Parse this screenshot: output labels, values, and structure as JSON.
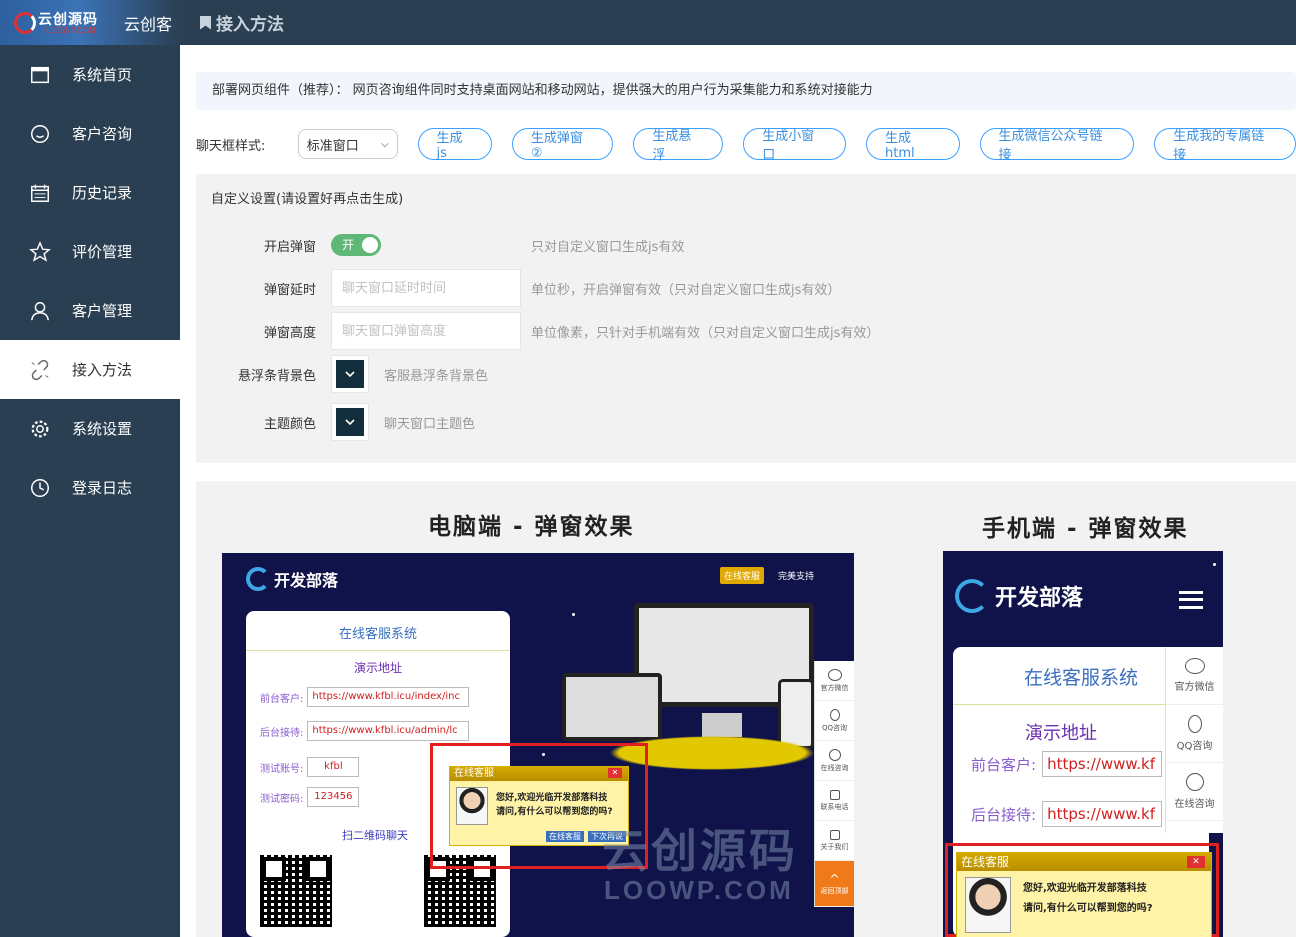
{
  "app": {
    "logo_text": "云创源码",
    "logo_sub": "LOOWP.COM",
    "name": "云创客"
  },
  "sidebar": {
    "items": [
      {
        "label": "系统首页",
        "icon": "window-icon"
      },
      {
        "label": "客户咨询",
        "icon": "smile-icon"
      },
      {
        "label": "历史记录",
        "icon": "calendar-icon"
      },
      {
        "label": "评价管理",
        "icon": "star-icon"
      },
      {
        "label": "客户管理",
        "icon": "users-icon"
      },
      {
        "label": "接入方法",
        "icon": "link-icon",
        "active": true
      },
      {
        "label": "系统设置",
        "icon": "gear-icon"
      },
      {
        "label": "登录日志",
        "icon": "clock-icon"
      }
    ]
  },
  "header": {
    "title": "接入方法"
  },
  "notice": "部署网页组件（推荐）： 网页咨询组件同时支持桌面网站和移动网站，提供强大的用户行为采集能力和系统对接能力",
  "style_row": {
    "label": "聊天框样式:",
    "select_value": "标准窗口",
    "buttons": [
      "生成js",
      "生成弹窗②",
      "生成悬浮",
      "生成小窗口",
      "生成html",
      "生成微信公众号链接",
      "生成我的专属链接"
    ]
  },
  "custom": {
    "title": "自定义设置(请设置好再点击生成)",
    "popup_toggle": {
      "label": "开启弹窗",
      "state": "开",
      "hint": "只对自定义窗口生成js有效"
    },
    "delay": {
      "label": "弹窗延时",
      "placeholder": "聊天窗口延时时间",
      "hint": "单位秒，开启弹窗有效（只对自定义窗口生成js有效）"
    },
    "height": {
      "label": "弹窗高度",
      "placeholder": "聊天窗口弹窗高度",
      "hint": "单位像素，只针对手机端有效（只对自定义窗口生成js有效）"
    },
    "float_color": {
      "label": "悬浮条背景色",
      "hint": "客服悬浮条背景色",
      "color": "#132e3c"
    },
    "theme_color": {
      "label": "主题颜色",
      "hint": "聊天窗口主题色",
      "color": "#132e3c"
    }
  },
  "preview": {
    "pc_title": "电脑端 - 弹窗效果",
    "mobile_title": "手机端 - 弹窗效果",
    "pc": {
      "brand": "开发部落",
      "nav_online": "在线客服",
      "nav_support": "完美支持",
      "card_title": "在线客服系统",
      "demo": "演示地址",
      "front_label": "前台客户:",
      "front_url": "https://www.kfbl.icu/index/inc",
      "back_label": "后台接待:",
      "back_url": "https://www.kfbl.icu/admin/lc",
      "account_label": "测试账号:",
      "account": "kfbl",
      "password_label": "测试密码:",
      "password": "123456",
      "scan": "扫二维码聊天",
      "popup_title": "在线客服",
      "popup_msg1": "您好,欢迎光临开发部落科技",
      "popup_msg2": "请问,有什么可以帮到您的吗?",
      "popup_btn1": "在线客服",
      "popup_btn2": "下次再说",
      "rail": [
        "官方微信",
        "QQ咨询",
        "在线咨询",
        "联系电话",
        "关于我们",
        "返回顶部"
      ]
    },
    "mobile": {
      "brand": "开发部落",
      "card_title": "在线客服系统",
      "demo": "演示地址",
      "front_label": "前台客户:",
      "front_url": "https://www.kf",
      "back_label": "后台接待:",
      "back_url": "https://www.kf",
      "popup_title": "在线客服",
      "popup_msg1": "您好,欢迎光临开发部落科技",
      "popup_msg2": "请问,有什么可以帮到您的吗?",
      "rail": [
        "官方微信",
        "QQ咨询",
        "在线咨询"
      ]
    },
    "watermark_cn": "云创源码",
    "watermark_en": "LOOWP.COM"
  }
}
